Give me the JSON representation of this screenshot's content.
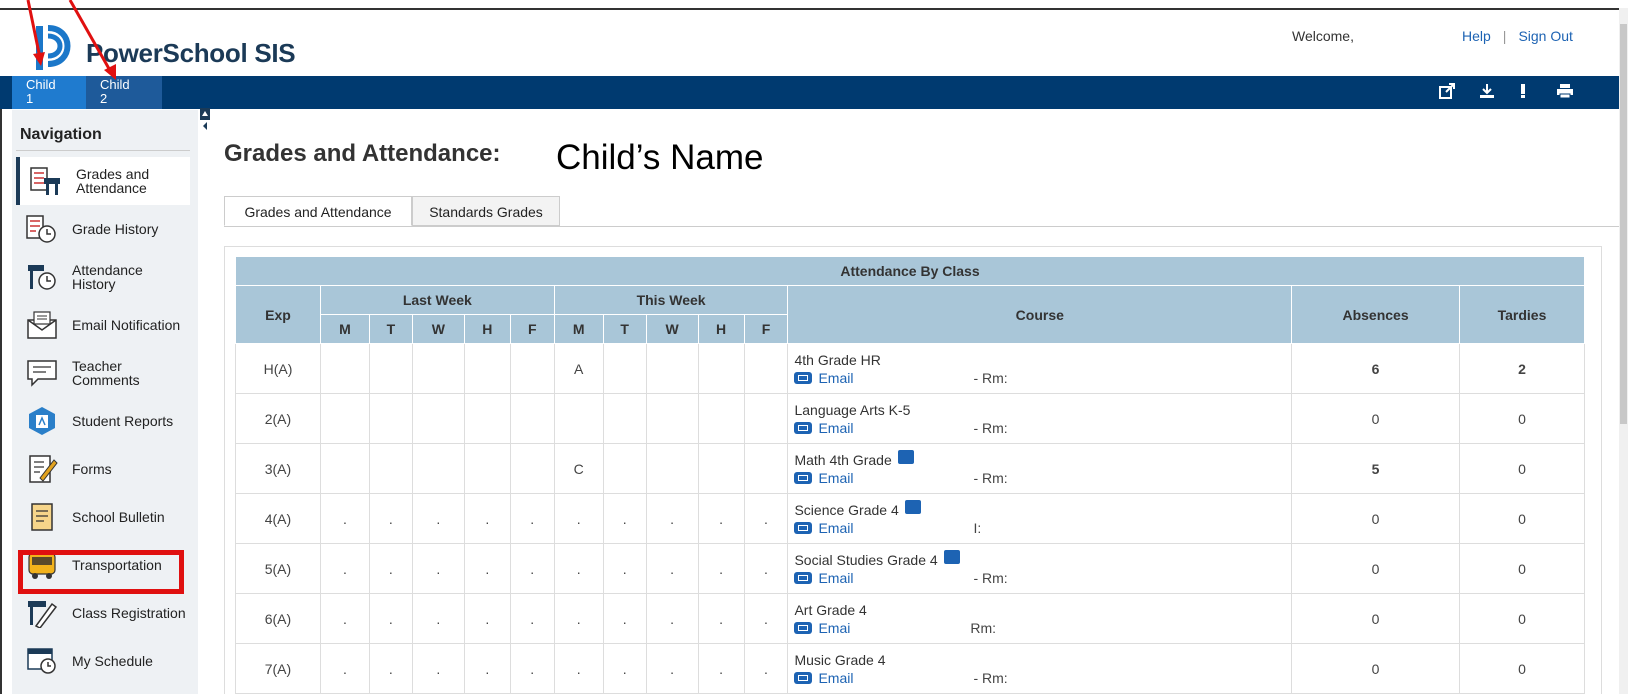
{
  "app": {
    "brand": "PowerSchool SIS",
    "welcome": "Welcome,",
    "help": "Help",
    "sign_out": "Sign Out"
  },
  "students": [
    {
      "label_line1": "Child",
      "label_line2": "1",
      "active": true
    },
    {
      "label_line1": "Child",
      "label_line2": "2",
      "active": false
    }
  ],
  "toolbar_icons": [
    "external-link-icon",
    "download-icon",
    "alert-icon",
    "print-icon"
  ],
  "nav": {
    "heading": "Navigation",
    "items": [
      {
        "label": "Grades and Attendance",
        "icon": "grades-attendance-icon"
      },
      {
        "label": "Grade History",
        "icon": "grade-history-icon"
      },
      {
        "label": "Attendance History",
        "icon": "attendance-history-icon"
      },
      {
        "label": "Email Notification",
        "icon": "email-notification-icon"
      },
      {
        "label": "Teacher Comments",
        "icon": "teacher-comments-icon"
      },
      {
        "label": "Student Reports",
        "icon": "student-reports-icon"
      },
      {
        "label": "Forms",
        "icon": "forms-icon"
      },
      {
        "label": "School Bulletin",
        "icon": "school-bulletin-icon"
      },
      {
        "label": "Transportation",
        "icon": "bus-icon"
      },
      {
        "label": "Class Registration",
        "icon": "class-registration-icon"
      },
      {
        "label": "My Schedule",
        "icon": "schedule-icon"
      }
    ]
  },
  "page": {
    "title": "Grades and Attendance:",
    "child_name": "Child’s Name",
    "tabs": [
      "Grades and Attendance",
      "Standards Grades"
    ]
  },
  "table": {
    "caption": "Attendance By Class",
    "headers": {
      "exp": "Exp",
      "last_week": "Last Week",
      "this_week": "This Week",
      "days": [
        "M",
        "T",
        "W",
        "H",
        "F"
      ],
      "course": "Course",
      "absences": "Absences",
      "tardies": "Tardies"
    },
    "rows": [
      {
        "exp": "H(A)",
        "last": [
          "",
          "",
          "",
          "",
          ""
        ],
        "this": [
          "A",
          "",
          "",
          "",
          ""
        ],
        "course": "4th Grade HR",
        "email": "Email",
        "room": "- Rm:",
        "group": false,
        "absences": "6",
        "tardies": "2",
        "abs_link": true,
        "tar_link": true
      },
      {
        "exp": "2(A)",
        "last": [
          "",
          "",
          "",
          "",
          ""
        ],
        "this": [
          "",
          "",
          "",
          "",
          ""
        ],
        "course": "Language Arts K-5",
        "email": "Email",
        "room": "- Rm:",
        "group": false,
        "absences": "0",
        "tardies": "0",
        "abs_link": false,
        "tar_link": false
      },
      {
        "exp": "3(A)",
        "last": [
          "",
          "",
          "",
          "",
          ""
        ],
        "this": [
          "C",
          "",
          "",
          "",
          ""
        ],
        "course": "Math 4th Grade",
        "email": "Email",
        "room": "- Rm:",
        "group": true,
        "absences": "5",
        "tardies": "0",
        "abs_link": true,
        "tar_link": false
      },
      {
        "exp": "4(A)",
        "last": [
          ".",
          ".",
          ".",
          ".",
          "."
        ],
        "this": [
          ".",
          ".",
          ".",
          ".",
          "."
        ],
        "course": "Science Grade 4",
        "email": "Email",
        "room": "I:",
        "group": true,
        "absences": "0",
        "tardies": "0",
        "abs_link": false,
        "tar_link": false
      },
      {
        "exp": "5(A)",
        "last": [
          ".",
          ".",
          ".",
          ".",
          "."
        ],
        "this": [
          ".",
          ".",
          ".",
          ".",
          "."
        ],
        "course": "Social Studies Grade 4",
        "email": "Email",
        "room": "- Rm:",
        "group": true,
        "absences": "0",
        "tardies": "0",
        "abs_link": false,
        "tar_link": false
      },
      {
        "exp": "6(A)",
        "last": [
          ".",
          ".",
          ".",
          ".",
          "."
        ],
        "this": [
          ".",
          ".",
          ".",
          ".",
          "."
        ],
        "course": "Art Grade 4",
        "email": "Emai",
        "room": "Rm:",
        "group": false,
        "absences": "0",
        "tardies": "0",
        "abs_link": false,
        "tar_link": false
      },
      {
        "exp": "7(A)",
        "last": [
          ".",
          ".",
          ".",
          ".",
          "."
        ],
        "this": [
          ".",
          ".",
          ".",
          ".",
          "."
        ],
        "course": "Music Grade 4",
        "email": "Email",
        "room": "- Rm:",
        "group": false,
        "absences": "0",
        "tardies": "0",
        "abs_link": false,
        "tar_link": false
      }
    ]
  },
  "colors": {
    "bar": "#003a70",
    "active_tab": "#1f7bcf",
    "header_cells": "#a9c6d8",
    "link": "#1d63b3",
    "highlight": "#e01010"
  }
}
